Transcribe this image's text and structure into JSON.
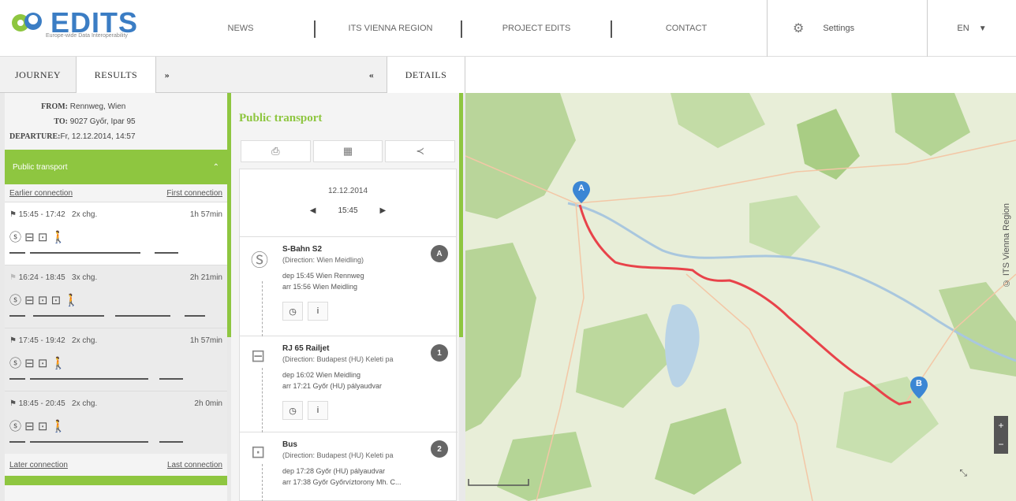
{
  "header": {
    "logo_text": "EDITS",
    "logo_sub": "Europe-wide Data Interoperability",
    "nav": [
      "NEWS",
      "ITS VIENNA REGION",
      "PROJECT EDITS",
      "CONTACT"
    ],
    "settings_label": "Settings",
    "language": "EN"
  },
  "tabs": {
    "journey": "JOURNEY",
    "results": "RESULTS",
    "expand": "»",
    "collapse": "«",
    "details": "DETAILS"
  },
  "trip": {
    "from_label": "FROM:",
    "from_value": "Rennweg, Wien",
    "to_label": "TO:",
    "to_value": "9027 Győr, Ipar 95",
    "departure_label": "DEPARTURE:",
    "departure_value": "Fr, 12.12.2014, 14:57"
  },
  "results": {
    "section_title": "Public transport",
    "earlier": "Earlier connection",
    "first": "First connection",
    "later": "Later connection",
    "last": "Last connection",
    "connections": [
      {
        "time": "15:45 - 17:42",
        "changes": "2x chg.",
        "duration": "1h 57min",
        "icons": "ⓢ ⊟ ⊡ 🚶"
      },
      {
        "time": "16:24 - 18:45",
        "changes": "3x chg.",
        "duration": "2h 21min",
        "icons": "ⓢ ⊟ ⊡ ⊡ 🚶"
      },
      {
        "time": "17:45 - 19:42",
        "changes": "2x chg.",
        "duration": "1h 57min",
        "icons": "ⓢ ⊟ ⊡ 🚶"
      },
      {
        "time": "18:45 - 20:45",
        "changes": "2x chg.",
        "duration": "2h 0min",
        "icons": "ⓢ ⊟ ⊡ 🚶"
      }
    ]
  },
  "details": {
    "title": "Public transport",
    "date": "12.12.2014",
    "time": "15:45",
    "legs": [
      {
        "name": "S-Bahn S2",
        "direction": "(Direction: Wien Meidling)",
        "dep": "dep 15:45 Wien Rennweg",
        "arr": "arr 15:56 Wien Meidling",
        "num": "A"
      },
      {
        "name": "RJ 65 Railjet",
        "direction": "(Direction: Budapest (HU) Keleti pa",
        "dep": "dep 16:02 Wien Meidling",
        "arr": "arr 17:21 Győr (HU) pályaudvar",
        "num": "1"
      },
      {
        "name": "Bus",
        "direction": "(Direction: Budapest (HU) Keleti pa",
        "dep": "dep 17:28 Győr (HU) pályaudvar",
        "arr": "arr 17:38 Győr Győrvíztorony Mh. C...",
        "num": "2"
      }
    ]
  },
  "map": {
    "watermark": "© ITS Vienna Region",
    "marker_a": "A",
    "marker_b": "B",
    "route_color": "#e8434a"
  }
}
